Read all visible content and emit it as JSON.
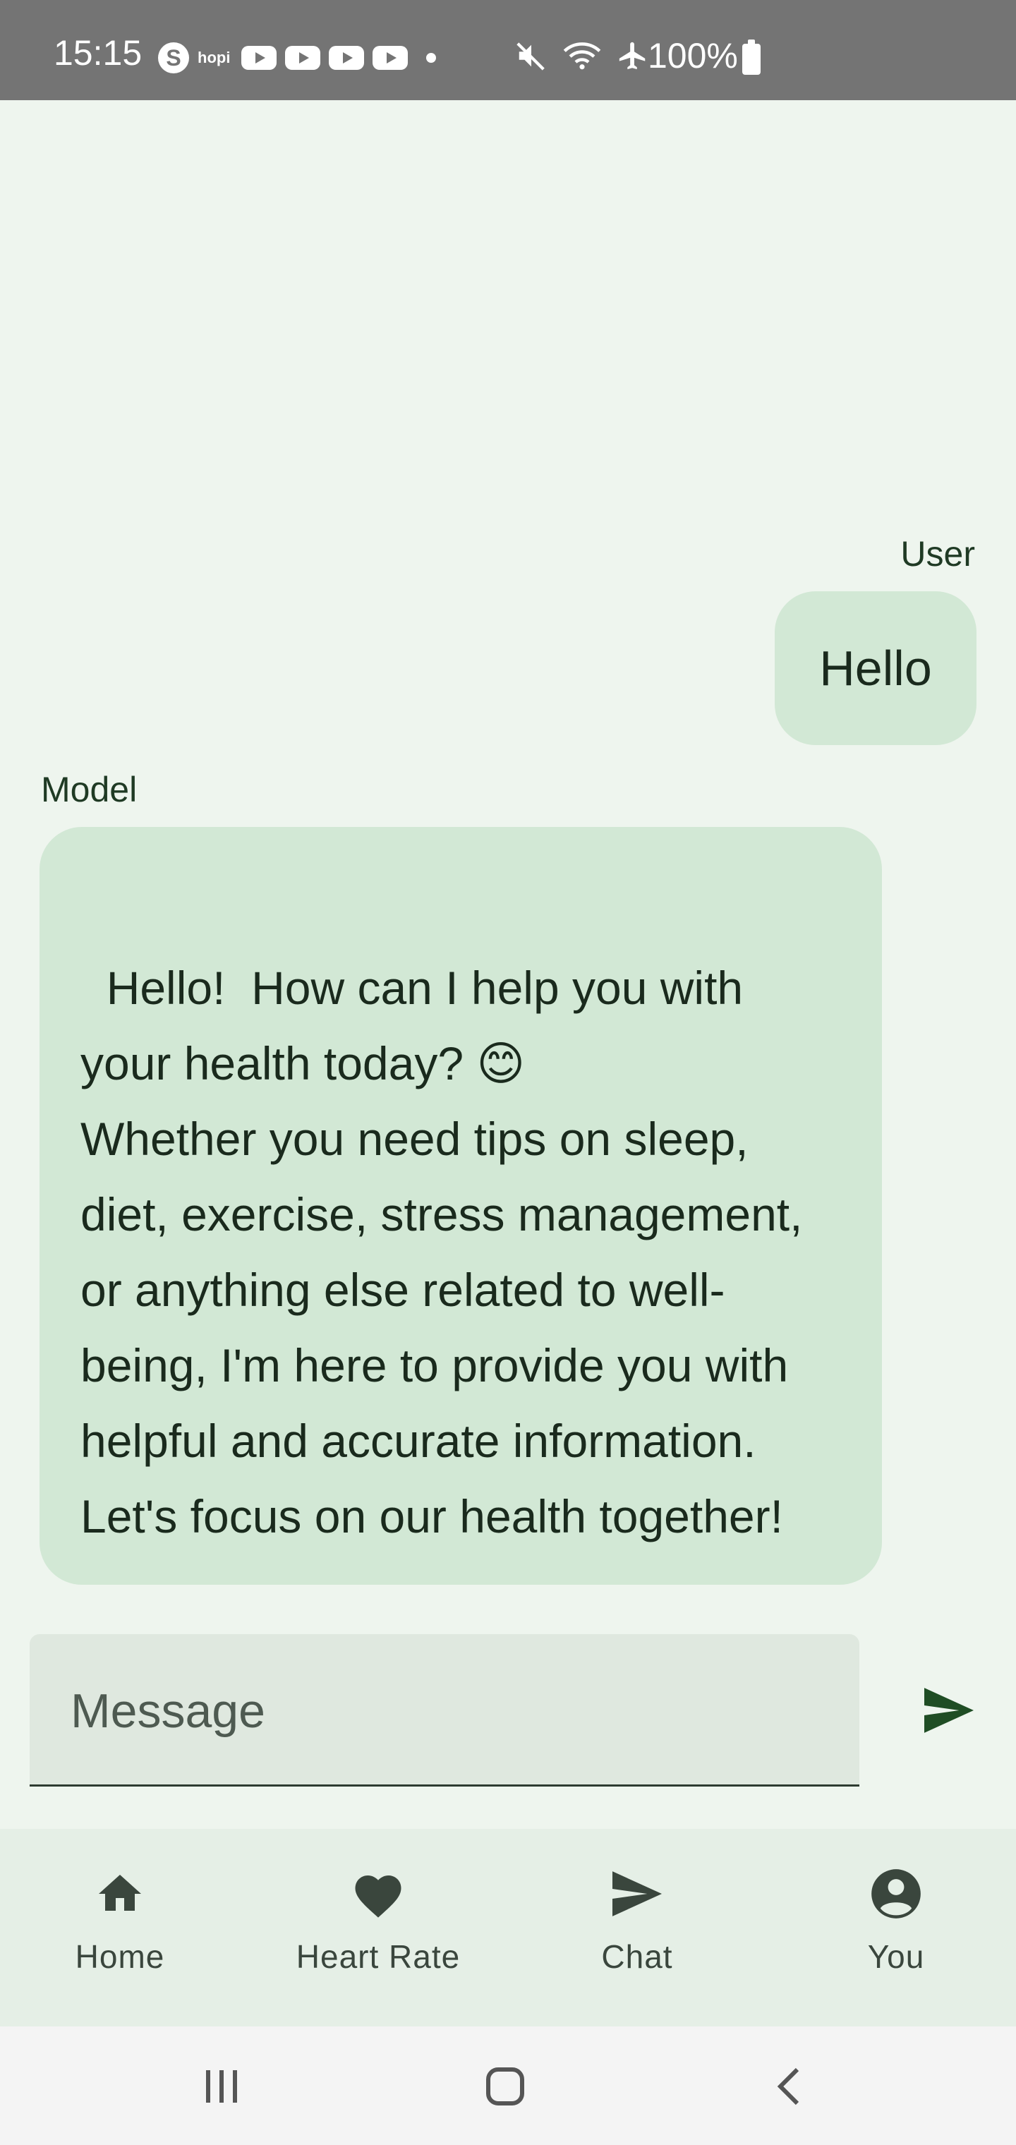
{
  "status_bar": {
    "time": "15:15",
    "app_badge": "hopi",
    "skype_letter": "S",
    "battery": "100%"
  },
  "chat": {
    "user_label": "User",
    "user_message": "Hello",
    "model_label": "Model",
    "model_message": "Hello!  How can I help you with your health today? 😊\nWhether you need tips on sleep, diet, exercise, stress management, or anything else related to well-being, I'm here to provide you with helpful and accurate information.  Let's focus on our health together!"
  },
  "composer": {
    "placeholder": "Message",
    "value": ""
  },
  "bottom_nav": {
    "items": [
      {
        "label": "Home",
        "icon": "home-icon"
      },
      {
        "label": "Heart Rate",
        "icon": "heart-icon"
      },
      {
        "label": "Chat",
        "icon": "send-icon"
      },
      {
        "label": "You",
        "icon": "account-circle-icon"
      }
    ]
  },
  "colors": {
    "background": "#eef5ee",
    "bubble": "#d2e8d5",
    "accent": "#1f4d24",
    "nav_background": "#e5efe6"
  }
}
